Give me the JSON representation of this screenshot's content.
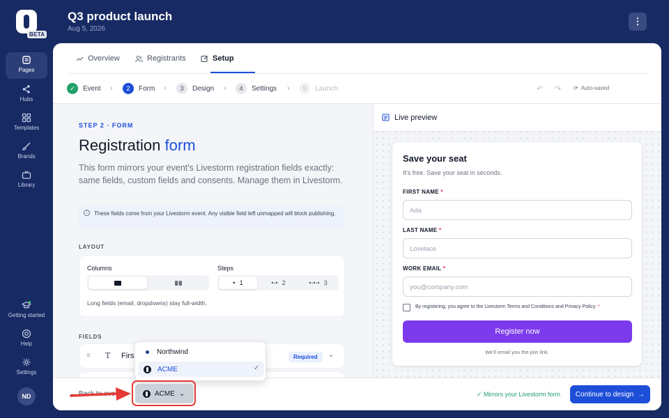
{
  "rail": {
    "beta": "BETA",
    "items": [
      {
        "label": "Pages",
        "icon": "pages-icon",
        "active": true
      },
      {
        "label": "Hubs",
        "icon": "hubs-icon"
      },
      {
        "label": "Templates",
        "icon": "templates-icon"
      },
      {
        "label": "Brands",
        "icon": "brush-icon"
      },
      {
        "label": "Library",
        "icon": "tv-icon"
      },
      {
        "label": "Getting started",
        "icon": "graduation-cap-icon"
      },
      {
        "label": "Help",
        "icon": "lifebuoy-icon"
      },
      {
        "label": "Settings",
        "icon": "gear-icon"
      }
    ],
    "avatar": "ND"
  },
  "header": {
    "title": "Q3 product launch",
    "date": "Aug 5, 2026",
    "menu": "⋮"
  },
  "tabs": [
    {
      "label": "Overview",
      "icon": "trend-icon"
    },
    {
      "label": "Registrants",
      "icon": "users-icon"
    },
    {
      "label": "Setup",
      "icon": "edit-icon",
      "active": true
    }
  ],
  "steps": [
    {
      "num": "✓",
      "label": "Event",
      "state": "done"
    },
    {
      "num": "2",
      "label": "Form",
      "state": "current"
    },
    {
      "num": "3",
      "label": "Design",
      "state": "todo"
    },
    {
      "num": "4",
      "label": "Settings",
      "state": "todo"
    },
    {
      "num": "5",
      "label": "Launch",
      "state": "disabled"
    }
  ],
  "autosaved": "Auto-saved",
  "form": {
    "eyebrow": "STEP 2 · FORM",
    "title_a": "Registration",
    "title_b": "form",
    "description": "This form mirrors your event's Livestorm registration fields exactly: same fields, custom fields and consents. Manage them in Livestorm.",
    "info": "These fields come from your Livestorm event. Any visible field left unmapped will block publishing.",
    "layout_label": "LAYOUT",
    "columns_label": "Columns",
    "steps_label": "Steps",
    "steps_opts": [
      "1",
      "2",
      "3"
    ],
    "layout_note": "Long fields (email, dropdowns) stay full-width.",
    "fields_label": "FIELDS",
    "field_name": "First",
    "required": "Required"
  },
  "preview": {
    "label": "Live preview",
    "title": "Save your seat",
    "subtitle": "It's free. Save your seat in seconds.",
    "fields": [
      {
        "label": "FIRST NAME",
        "placeholder": "Ada"
      },
      {
        "label": "LAST NAME",
        "placeholder": "Lovelace"
      },
      {
        "label": "WORK EMAIL",
        "placeholder": "you@company.com"
      }
    ],
    "consent": "By registering, you agree to the Livestorm Terms and Conditions and Privacy Policy.",
    "button": "Register now",
    "footnote": "We'll email you the join link."
  },
  "footer": {
    "back": "← Back to eve",
    "mirrors": "✓ Mirrors your Livestorm form",
    "continue": "Continue to design",
    "continue_arrow": "→"
  },
  "workspace": {
    "current": "ACME",
    "options": [
      {
        "label": "Northwind",
        "selected": false
      },
      {
        "label": "ACME",
        "selected": true
      }
    ]
  },
  "colors": {
    "brand": "#182a63",
    "accent": "#1d4ed8",
    "cta": "#7c3aed",
    "success": "#22a06b",
    "highlight": "#e53935"
  }
}
